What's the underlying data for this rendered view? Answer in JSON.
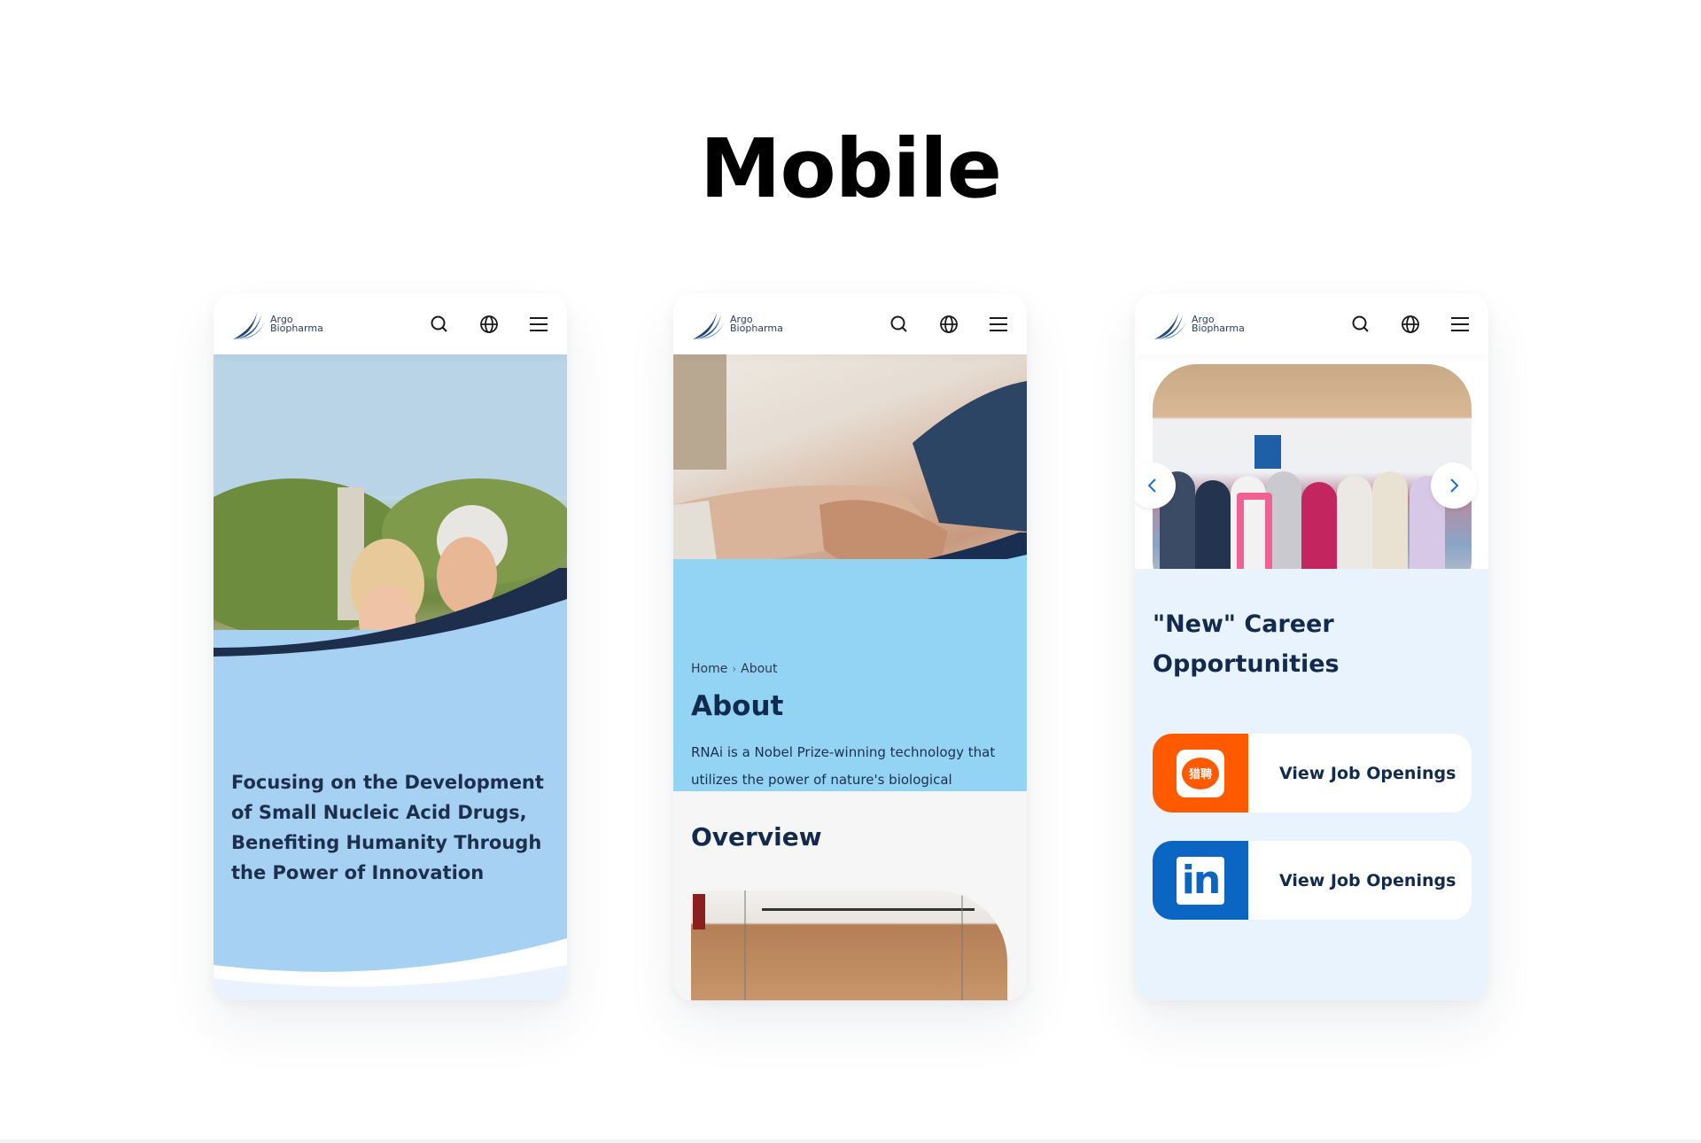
{
  "page": {
    "title": "Mobile"
  },
  "brand": {
    "name_line1": "Argo",
    "name_line2": "Biopharma",
    "colors": {
      "navy": "#1e2f4e",
      "light_blue": "#a6d1f2",
      "sky_blue": "#93d3f4",
      "pale_blue": "#e9f3fd",
      "liepin_orange": "#ff5a00",
      "linkedin_blue": "#0a66c2"
    }
  },
  "header": {
    "icons": [
      "search-icon",
      "globe-icon",
      "menu-icon"
    ]
  },
  "phone_home": {
    "hero_image": "senior couple outdoors",
    "tagline": "Focusing on the Development of Small Nucleic Acid Drugs, Benefiting Humanity Through the Power of Innovation"
  },
  "phone_about": {
    "hero_image": "holding hands",
    "breadcrumb": {
      "home": "Home",
      "separator": ">",
      "current": "About"
    },
    "title": "About",
    "description": "RNAi is a Nobel Prize-winning technology that utilizes the power of nature's biological mechanisms to silence targeted genes.",
    "overview_title": "Overview",
    "overview_image": "office interior"
  },
  "phone_careers": {
    "carousel_image": "team group photo",
    "carousel_prev": "chevron-left-icon",
    "carousel_next": "chevron-right-icon",
    "title": "\"New\" Career Opportunities",
    "jobs": [
      {
        "platform": "Liepin",
        "logo_text": "猎聘",
        "label": "View Job Openings"
      },
      {
        "platform": "LinkedIn",
        "logo_text": "in",
        "label": "View Job Openings"
      }
    ]
  }
}
